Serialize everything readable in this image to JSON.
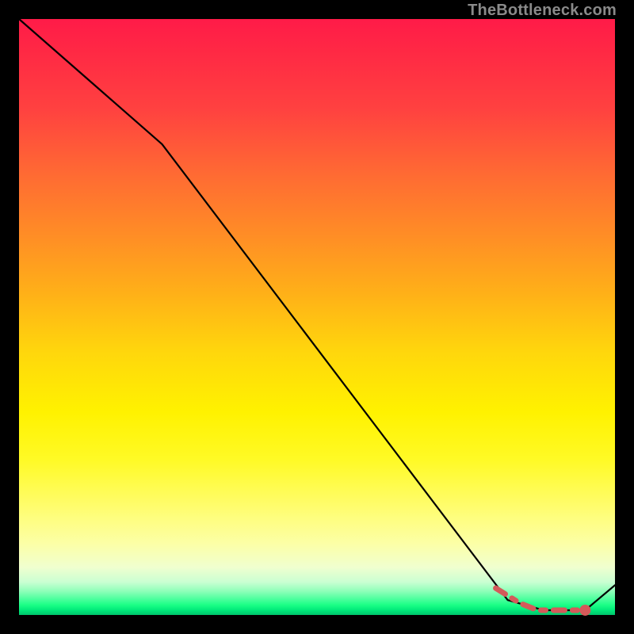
{
  "attribution": "TheBottleneck.com",
  "colors": {
    "line": "#000000",
    "highlight": "#d45a5a",
    "gradient_top": "#ff1b48",
    "gradient_bottom": "#00c46c"
  },
  "chart_data": {
    "type": "line",
    "title": "",
    "xlabel": "",
    "ylabel": "",
    "xlim": [
      0,
      100
    ],
    "ylim": [
      0,
      100
    ],
    "x": [
      0,
      24,
      82,
      88,
      95,
      100
    ],
    "y": [
      100,
      79,
      2.5,
      0.8,
      0.8,
      5
    ],
    "highlight_segment": {
      "note": "flat valley region drawn as dashed salmon overlay with terminal dot",
      "x": [
        80,
        84,
        87,
        91,
        95
      ],
      "y": [
        4.5,
        2.0,
        0.8,
        0.8,
        0.8
      ],
      "dot": {
        "x": 95,
        "y": 0.8
      }
    }
  }
}
